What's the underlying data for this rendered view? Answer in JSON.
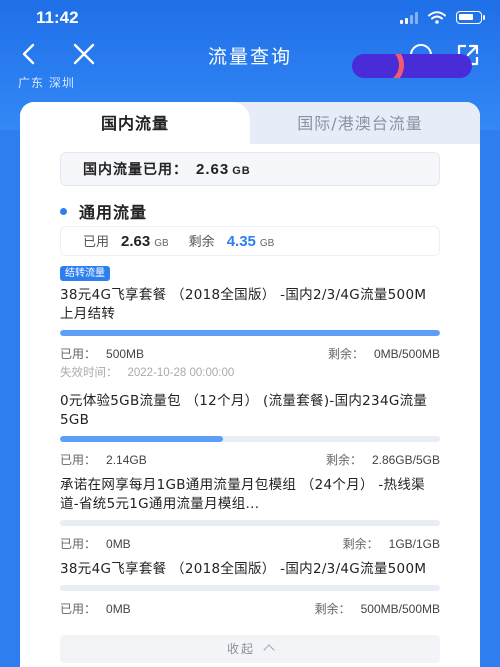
{
  "status_bar": {
    "time": "11:42"
  },
  "nav": {
    "title": "流量查询",
    "service_number": "10086"
  },
  "location": "广东  深圳",
  "tabs": [
    {
      "label": "国内流量",
      "active": true
    },
    {
      "label": "国际/港澳台流量",
      "active": false
    }
  ],
  "summary": {
    "label": "国内流量已用：",
    "value": "2.63",
    "unit": "GB"
  },
  "general": {
    "title": "通用流量",
    "used_label": "已用",
    "used_value": "2.63",
    "used_unit": "GB",
    "remain_label": "剩余",
    "remain_value": "4.35",
    "remain_unit": "GB"
  },
  "carry_tag": "结转流量",
  "packages": [
    {
      "name": "38元4G飞享套餐 （2018全国版） -国内2/3/4G流量500M上月结转",
      "used_label": "已用：",
      "used": "500MB",
      "remain_label": "剩余：",
      "remain": "0MB/500MB",
      "progress": 1.0,
      "expire_label": "失效时间：",
      "expire": "2022-10-28 00:00:00"
    },
    {
      "name": "0元体验5GB流量包 （12个月） (流量套餐)-国内234G流量5GB",
      "used_label": "已用：",
      "used": "2.14GB",
      "remain_label": "剩余：",
      "remain": "2.86GB/5GB",
      "progress": 0.43
    },
    {
      "name": "承诺在网享每月1GB通用流量月包模组 （24个月） -热线渠道-省统5元1G通用流量月模组...",
      "used_label": "已用：",
      "used": "0MB",
      "remain_label": "剩余：",
      "remain": "1GB/1GB",
      "progress": 0.0
    },
    {
      "name": "38元4G飞享套餐 （2018全国版） -国内2/3/4G流量500M",
      "used_label": "已用：",
      "used": "0MB",
      "remain_label": "剩余：",
      "remain": "500MB/500MB",
      "progress": 0.0
    }
  ],
  "collapse_label": "收起",
  "colors": {
    "primary": "#2f7ef0",
    "bar_fill": "#5ba0f6",
    "bar_track": "#e9eef6"
  },
  "icons": [
    "back-icon",
    "close-icon",
    "customer-service-icon",
    "share-icon",
    "signal-icon",
    "wifi-icon",
    "battery-icon",
    "chevron-up-icon"
  ]
}
